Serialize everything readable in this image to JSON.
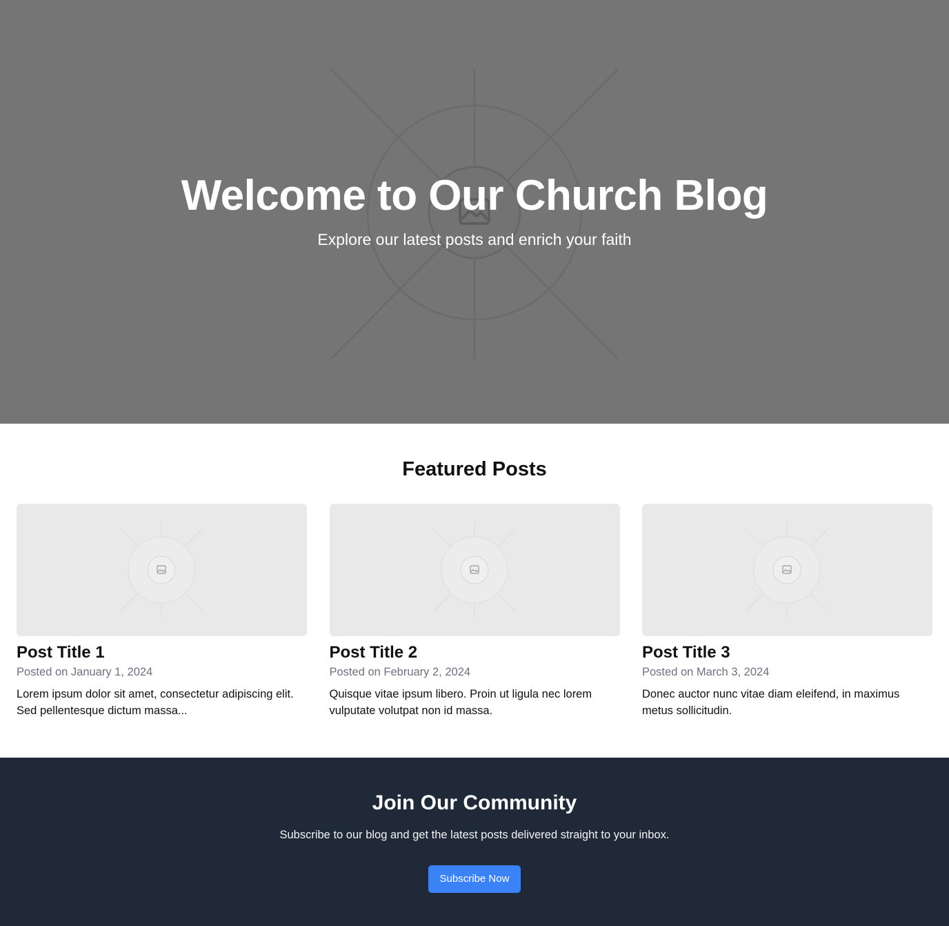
{
  "hero": {
    "title": "Welcome to Our Church Blog",
    "subtitle": "Explore our latest posts and enrich your faith",
    "background_color": "#757575",
    "image_icon": "image-placeholder-icon"
  },
  "featured": {
    "heading": "Featured Posts",
    "posts": [
      {
        "title": "Post Title 1",
        "date": "Posted on January 1, 2024",
        "excerpt": "Lorem ipsum dolor sit amet, consectetur adipiscing elit. Sed pellentesque dictum massa...",
        "image_icon": "image-placeholder-icon"
      },
      {
        "title": "Post Title 2",
        "date": "Posted on February 2, 2024",
        "excerpt": "Quisque vitae ipsum libero. Proin ut ligula nec lorem vulputate volutpat non id massa.",
        "image_icon": "image-placeholder-icon"
      },
      {
        "title": "Post Title 3",
        "date": "Posted on March 3, 2024",
        "excerpt": "Donec auctor nunc vitae diam eleifend, in maximus metus sollicitudin.",
        "image_icon": "image-placeholder-icon"
      }
    ]
  },
  "community": {
    "title": "Join Our Community",
    "text": "Subscribe to our blog and get the latest posts delivered straight to your inbox.",
    "button_label": "Subscribe Now",
    "background_color": "#1f2937",
    "button_color": "#3b82f6"
  }
}
